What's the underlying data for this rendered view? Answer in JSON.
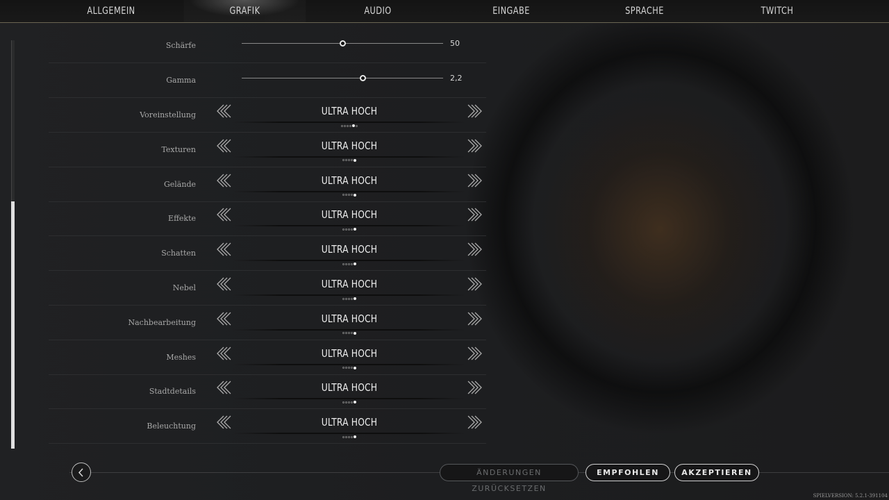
{
  "tabs": [
    {
      "label": "ALLGEMEIN"
    },
    {
      "label": "GRAFIK",
      "active": true
    },
    {
      "label": "AUDIO"
    },
    {
      "label": "EINGABE"
    },
    {
      "label": "SPRACHE"
    },
    {
      "label": "TWITCH"
    }
  ],
  "sliders": [
    {
      "label": "Schärfe",
      "value": "50",
      "fraction": 0.5
    },
    {
      "label": "Gamma",
      "value": "2,2",
      "fraction": 0.6
    }
  ],
  "selectors": [
    {
      "label": "Voreinstellung",
      "value": "ULTRA HOCH",
      "dots": 6,
      "selected": 5
    },
    {
      "label": "Texturen",
      "value": "ULTRA HOCH",
      "dots": 5,
      "selected": 5
    },
    {
      "label": "Gelände",
      "value": "ULTRA HOCH",
      "dots": 5,
      "selected": 5
    },
    {
      "label": "Effekte",
      "value": "ULTRA HOCH",
      "dots": 5,
      "selected": 5
    },
    {
      "label": "Schatten",
      "value": "ULTRA HOCH",
      "dots": 5,
      "selected": 5
    },
    {
      "label": "Nebel",
      "value": "ULTRA HOCH",
      "dots": 5,
      "selected": 5
    },
    {
      "label": "Nachbearbeitung",
      "value": "ULTRA HOCH",
      "dots": 5,
      "selected": 5
    },
    {
      "label": "Meshes",
      "value": "ULTRA HOCH",
      "dots": 5,
      "selected": 5
    },
    {
      "label": "Stadtdetails",
      "value": "ULTRA HOCH",
      "dots": 5,
      "selected": 5
    },
    {
      "label": "Beleuchtung",
      "value": "ULTRA HOCH",
      "dots": 5,
      "selected": 5
    }
  ],
  "footer": {
    "reset_label": "ÄNDERUNGEN ZURÜCKSETZEN",
    "recommended_label": "EMPFOHLEN",
    "accept_label": "AKZEPTIEREN",
    "version": "SPIELVERSION: 5.2.1-391104"
  },
  "icons": {
    "back": "chevron-left-icon",
    "prev": "double-chevron-left-icon",
    "next": "double-chevron-right-icon"
  }
}
